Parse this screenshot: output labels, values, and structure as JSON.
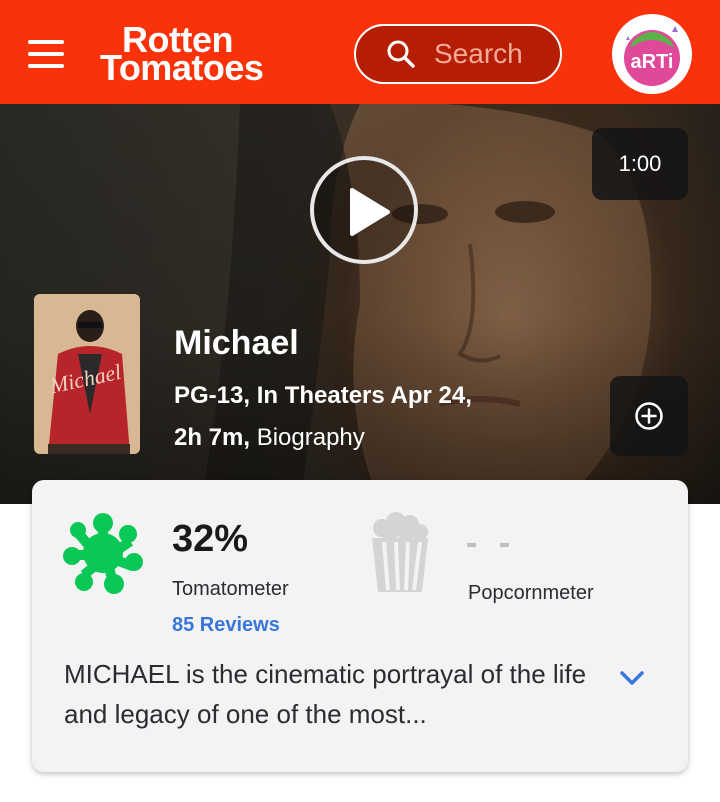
{
  "header": {
    "logo_line1": "Rotten",
    "logo_line2": "Tomatoes",
    "search_placeholder": "Search",
    "avatar_text": "aRTi"
  },
  "hero": {
    "duration": "1:00",
    "title": "Michael",
    "rating_release": "PG-13, In Theaters Apr 24,",
    "runtime": "2h 7m,",
    "genre": "Biography",
    "poster_text": "Michael"
  },
  "scores": {
    "tomatometer_value": "32%",
    "tomatometer_label": "Tomatometer",
    "reviews_link": "85 Reviews",
    "popcornmeter_value": "- -",
    "popcornmeter_label": "Popcornmeter"
  },
  "synopsis": "MICHAEL is the cinematic portrayal of the life and legacy of one of the most...",
  "colors": {
    "brand_red": "#fa320a",
    "rotten_green": "#0ac855",
    "link_blue": "#3976dc"
  },
  "icons": [
    "menu-icon",
    "search-icon",
    "play-icon",
    "plus-circle-icon",
    "splat-icon",
    "popcorn-icon",
    "chevron-down-icon"
  ]
}
